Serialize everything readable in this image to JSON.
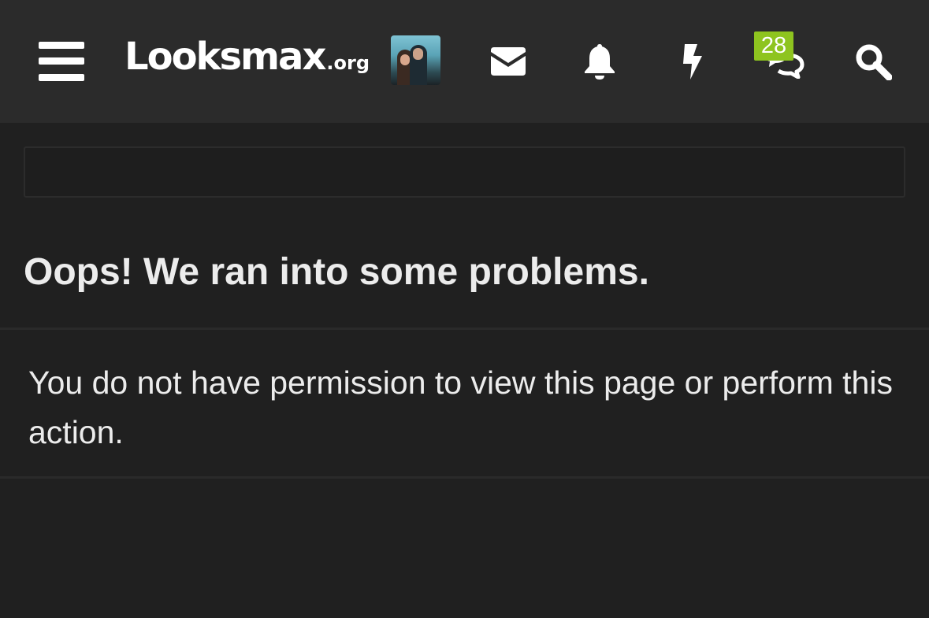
{
  "header": {
    "logo_main": "Looksmax",
    "logo_suffix": ".org",
    "menu_icon": "hamburger-menu-icon",
    "icons": {
      "inbox": "envelope-icon",
      "alerts": "bell-icon",
      "whats_new": "lightning-bolt-icon",
      "conversations": "chat-bubbles-icon",
      "search": "search-icon"
    },
    "conversations_badge": "28",
    "badge_color": "#8ec41f"
  },
  "error": {
    "title": "Oops! We ran into some problems.",
    "message": "You do not have permission to view this page or perform this action."
  },
  "colors": {
    "header_bg": "#2b2b2b",
    "page_bg": "#202020",
    "text": "#ececec"
  }
}
